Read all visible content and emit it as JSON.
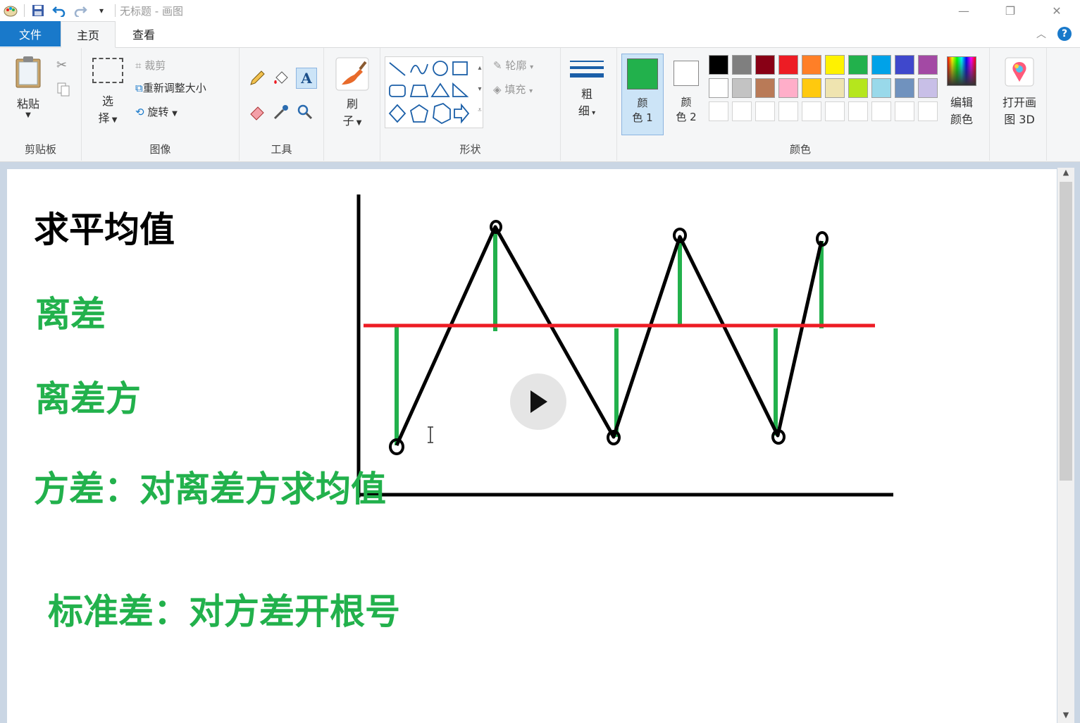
{
  "window": {
    "title": "无标题 - 画图"
  },
  "tabs": {
    "file": "文件",
    "home": "主页",
    "view": "查看"
  },
  "ribbon": {
    "clipboard": {
      "paste": "粘贴",
      "group": "剪贴板"
    },
    "image": {
      "select": "选",
      "select2": "择",
      "crop": "裁剪",
      "resize": "重新调整大小",
      "rotate": "旋转",
      "group": "图像"
    },
    "tools": {
      "group": "工具"
    },
    "brushes": {
      "label": "刷",
      "label2": "子"
    },
    "shapes": {
      "outline": "轮廓",
      "fill": "填充",
      "group": "形状"
    },
    "size": {
      "label": "粗",
      "label2": "细"
    },
    "colors": {
      "color1": "颜",
      "color1b": "色 1",
      "color2": "颜",
      "color2b": "色 2",
      "edit": "编辑",
      "edit2": "颜色",
      "group": "颜色",
      "color1_value": "#22b14c",
      "palette_row1": [
        "#000000",
        "#7f7f7f",
        "#880015",
        "#ed1c24",
        "#ff7f27",
        "#fff200",
        "#22b14c",
        "#00a2e8",
        "#3f48cc",
        "#a349a4"
      ],
      "palette_row2": [
        "#ffffff",
        "#c3c3c3",
        "#b97a57",
        "#ffaec9",
        "#ffc90e",
        "#efe4b0",
        "#b5e61d",
        "#99d9ea",
        "#7092be",
        "#c8bfe7"
      ]
    },
    "paint3d": {
      "label": "打开画",
      "label2": "图 3D"
    }
  },
  "canvas": {
    "t1": "求平均值",
    "t2": "离差",
    "t3": "离差方",
    "t4": "方差：对离差方求均值",
    "t5": "标准差：对方差开根号",
    "accent_green": "#22b14c",
    "mean_line_color": "#ed1c24"
  }
}
